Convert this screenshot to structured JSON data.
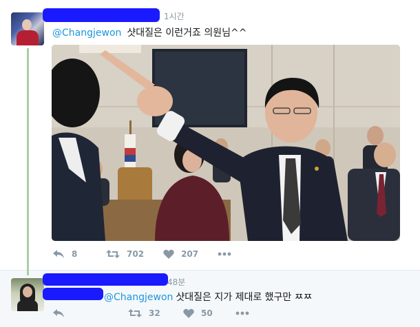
{
  "tweet": {
    "time": "1시간",
    "mention": "@Changjewon",
    "text": "샷대질은 이런거죠 의원님^^",
    "actions": {
      "reply_count": "8",
      "retweet_count": "702",
      "like_count": "207"
    }
  },
  "reply": {
    "time": "48분",
    "mention": "@Changjewon",
    "text": "샷대질은 지가 제대로 했구만 ㅉㅉ",
    "actions": {
      "reply_count": "",
      "retweet_count": "32",
      "like_count": "50"
    }
  },
  "colors": {
    "mention": "#1b95e0",
    "action_gray": "#8899a6",
    "thread_line": "#a5d1a0",
    "redaction": "#1a1aff"
  },
  "icons": [
    "reply-icon",
    "retweet-icon",
    "heart-icon",
    "more-icon"
  ]
}
